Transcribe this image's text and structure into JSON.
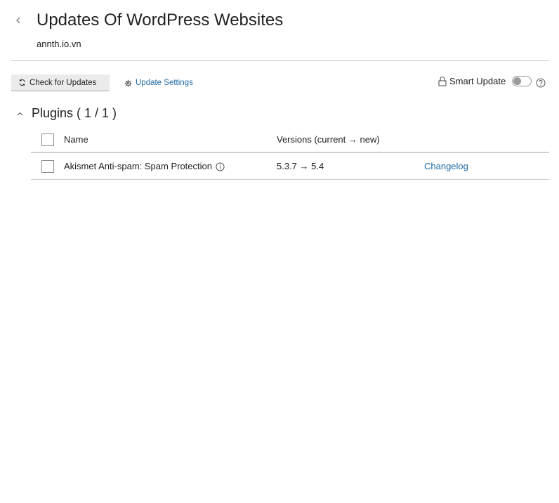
{
  "header": {
    "back_icon": "chevron-left-icon",
    "title": "Updates Of WordPress Websites",
    "subtitle": "annth.io.vn"
  },
  "toolbar": {
    "check_label": "Check for Updates",
    "check_icon": "refresh-icon",
    "settings_label": "Update Settings",
    "settings_icon": "gear-icon",
    "smart_update_label": "Smart Update",
    "smart_update_icon": "lock-icon",
    "smart_update_enabled": false,
    "help_icon": "question-icon"
  },
  "plugins": {
    "section_label": "Plugins ( 1 / 1 )",
    "expanded": true,
    "columns": {
      "name": "Name",
      "versions": "Versions (current → new)"
    },
    "rows": [
      {
        "name": "Akismet Anti-spam: Spam Protection",
        "info_icon": "info-icon",
        "versions": "5.3.7 → 5.4",
        "link": "Changelog",
        "checked": false
      }
    ]
  },
  "colors": {
    "link": "#1f6aa5",
    "text": "#222222",
    "divider": "#c9c9c9",
    "button_bg": "#ebebeb"
  }
}
